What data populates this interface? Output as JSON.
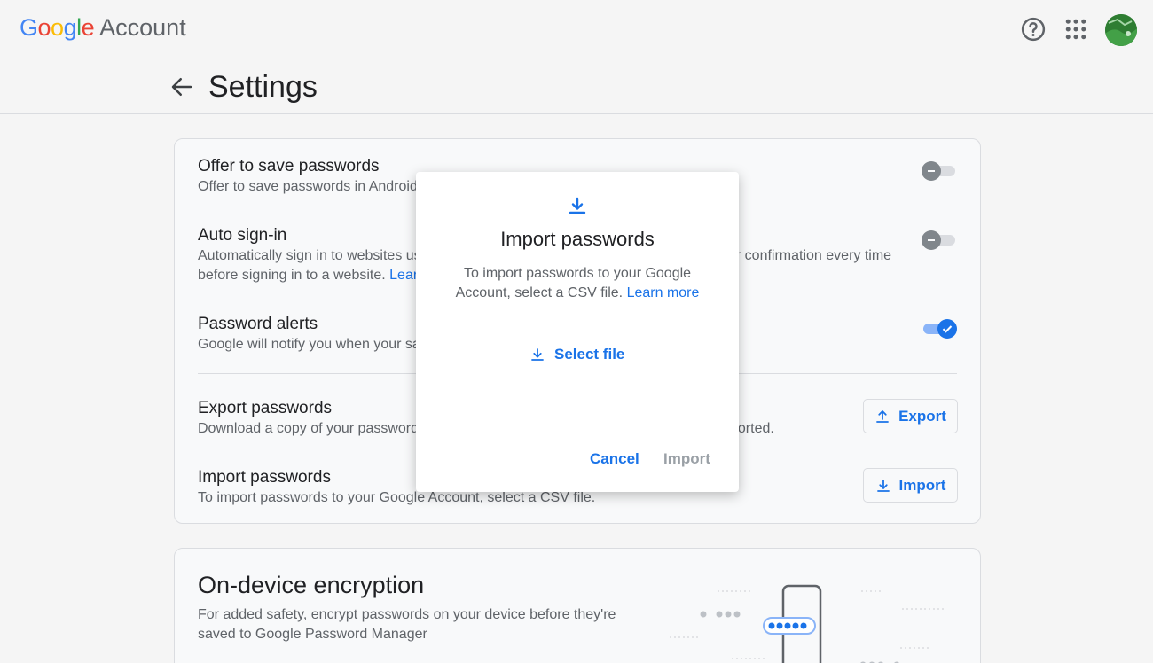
{
  "app": {
    "logo_google": "Google",
    "logo_account": "Account"
  },
  "header": {
    "title": "Settings"
  },
  "settings": {
    "offer_save": {
      "title": "Offer to save passwords",
      "desc": "Offer to save passwords in Android a",
      "enabled": false
    },
    "auto_signin": {
      "title": "Auto sign-in",
      "desc_line1_left": "Automatically sign in to websites usi",
      "desc_line1_right": "or confirmation every time",
      "desc_line2": "before signing in to a website.",
      "link": "Learn",
      "enabled": false
    },
    "alerts": {
      "title": "Password alerts",
      "desc": "Google will notify you when your sav",
      "enabled": true
    },
    "export": {
      "title": "Export passwords",
      "desc_left": "Download a copy of your passwords",
      "desc_right": "ported.",
      "button": "Export"
    },
    "import": {
      "title": "Import passwords",
      "desc": "To import passwords to your Google Account, select a CSV file.",
      "button": "Import"
    }
  },
  "encryption": {
    "title": "On-device encryption",
    "desc": "For added safety, encrypt passwords on your device before they're saved to Google Password Manager"
  },
  "dialog": {
    "title": "Import passwords",
    "desc": "To import passwords to your Google Account, select a CSV file.",
    "link": "Learn more",
    "select_file": "Select file",
    "cancel": "Cancel",
    "import": "Import"
  },
  "colors": {
    "accent": "#1a73e8",
    "disabled": "#9aa0a6",
    "background": "#f5f5f5"
  },
  "icons": {
    "help": "help-icon",
    "apps": "apps-grid-icon",
    "back": "back-arrow-icon",
    "download": "download-icon",
    "upload": "upload-icon"
  }
}
